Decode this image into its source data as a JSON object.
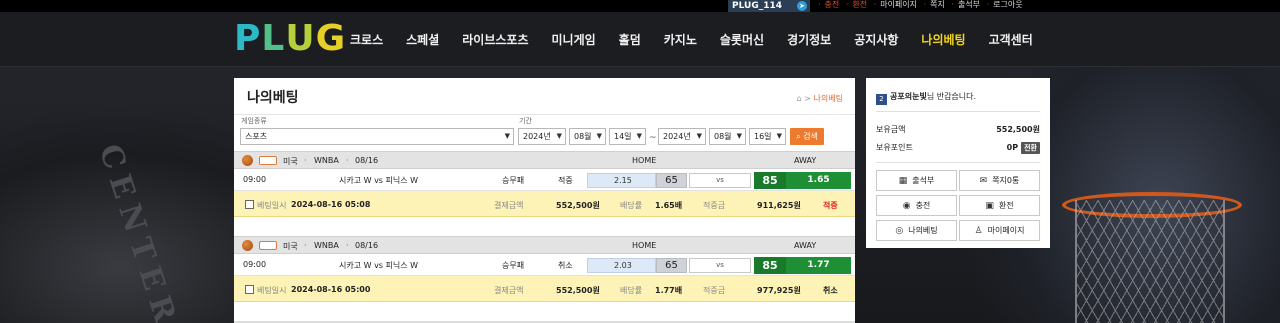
{
  "topbar": {
    "telegram_label": "PLUG_114",
    "links": [
      "충전",
      "환전",
      "마이페이지",
      "쪽지",
      "출석부",
      "로그아웃"
    ]
  },
  "header": {
    "logo_letters": [
      "P",
      "L",
      "U",
      "G"
    ],
    "nav": [
      "크로스",
      "스페셜",
      "라이브스포츠",
      "미니게임",
      "홀덤",
      "카지노",
      "슬롯머신",
      "경기정보",
      "공지사항",
      "나의베팅",
      "고객센터"
    ],
    "active_nav": "나의베팅"
  },
  "page": {
    "title": "나의베팅",
    "breadcrumb_current": "나의베팅"
  },
  "filter": {
    "game_type_label": "게임종류",
    "game_type_value": "스포츠",
    "period_label": "기간",
    "from": {
      "year": "2024년",
      "month": "08월",
      "day": "14일"
    },
    "separator": "~",
    "to": {
      "year": "2024년",
      "month": "08월",
      "day": "16일"
    },
    "search_label": "검색"
  },
  "bets": [
    {
      "country": "미국",
      "league": "WNBA",
      "date": "08/16",
      "home_header": "HOME",
      "away_header": "AWAY",
      "time": "09:00",
      "match": "시카고 W vs 피닉스 W",
      "market": "승무패",
      "result": "적중",
      "home_odds": "2.15",
      "home_score": "65",
      "vs": "vs",
      "away_score": "85",
      "away_odds": "1.65",
      "bet_time_label": "베팅일시",
      "bet_time": "2024-08-16 05:08",
      "amount_label": "결제금액",
      "amount": "552,500원",
      "multiplier_label": "배당률",
      "multiplier": "1.65배",
      "payout_label": "적중금",
      "payout": "911,625원",
      "status": "적중"
    },
    {
      "country": "미국",
      "league": "WNBA",
      "date": "08/16",
      "home_header": "HOME",
      "away_header": "AWAY",
      "time": "09:00",
      "match": "시카고 W vs 피닉스 W",
      "market": "승무패",
      "result": "취소",
      "home_odds": "2.03",
      "home_score": "65",
      "vs": "vs",
      "away_score": "85",
      "away_odds": "1.77",
      "bet_time_label": "베팅일시",
      "bet_time": "2024-08-16 05:00",
      "amount_label": "결제금액",
      "amount": "552,500원",
      "multiplier_label": "배당률",
      "multiplier": "1.77배",
      "payout_label": "적중금",
      "payout": "977,925원",
      "status": "취소"
    }
  ],
  "sidebar": {
    "level": "2",
    "username": "공포의눈빛",
    "greeting_suffix": "님 반갑습니다.",
    "balance_label": "보유금액",
    "balance": "552,500원",
    "points_label": "보유포인트",
    "points": "0P",
    "convert_label": "전환",
    "buttons": [
      "출석부",
      "쪽지0통",
      "충전",
      "환전",
      "나의베팅",
      "마이페이지"
    ]
  },
  "colors": {
    "accent_orange": "#ee7a2e",
    "nav_active": "#f2d21a",
    "away_green": "#1e8f35",
    "win_red": "#e2281d"
  }
}
